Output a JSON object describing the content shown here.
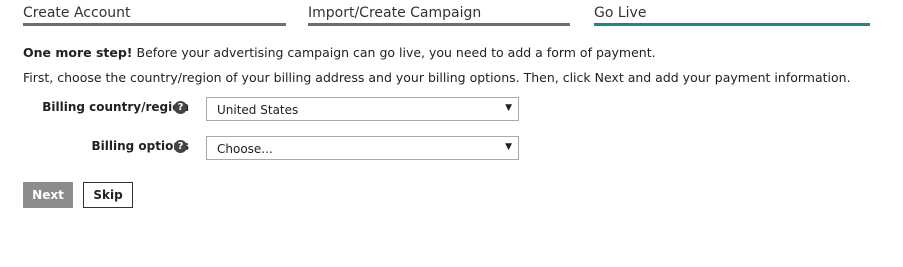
{
  "steps": [
    {
      "label": "Create Account",
      "state": "done"
    },
    {
      "label": "Import/Create Campaign",
      "state": "done"
    },
    {
      "label": "Go Live",
      "state": "current"
    }
  ],
  "intro": {
    "lead_bold": "One more step!",
    "lead_text": " Before your advertising campaign can go live, you need to add a form of payment.",
    "line2": "First, choose the country/region of your billing address and your billing options. Then, click Next and add your payment information."
  },
  "form": {
    "country": {
      "label": "Billing country/region",
      "help": "?",
      "value": "United States"
    },
    "billing": {
      "label": "Billing options",
      "help": "?",
      "value": "Choose..."
    }
  },
  "buttons": {
    "next": "Next",
    "skip": "Skip"
  },
  "colors": {
    "active_step": "#1a8a7c",
    "inactive_step": "#6e6e6e",
    "next_bg": "#8c8c8c"
  },
  "icons": {
    "help": "question-circle-icon",
    "dropdown": "chevron-down-icon"
  }
}
